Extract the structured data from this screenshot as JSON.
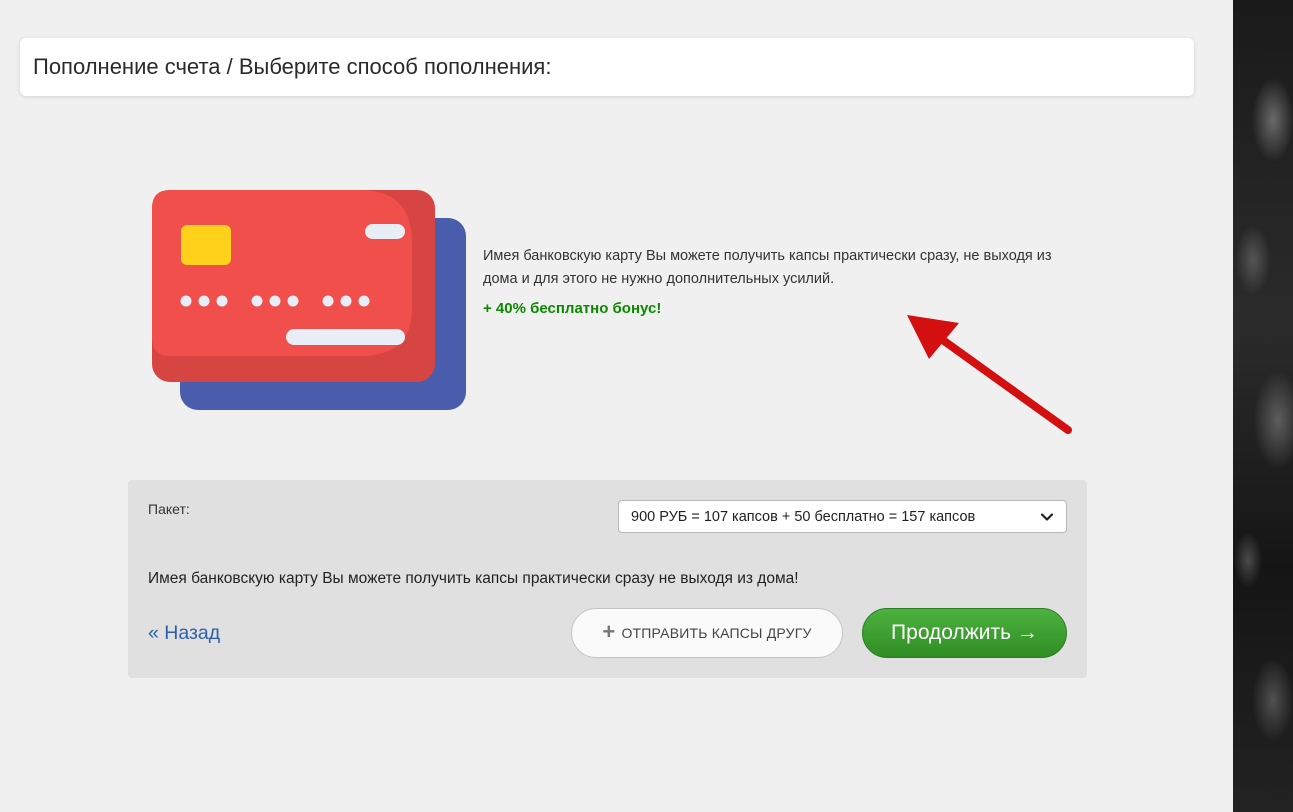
{
  "header": {
    "title": "Пополнение счета / Выберите способ пополнения:"
  },
  "info": {
    "description": "Имея банковскую карту Вы можете получить капсы практически сразу, не выходя из дома и для этого не нужно дополнительных усилий.",
    "bonus": "+ 40% бесплатно бонус!"
  },
  "form": {
    "package_label": "Пакет:",
    "package_selected": "900 РУБ = 107 капсов + 50 бесплатно = 157 капсов",
    "note": "Имея банковскую карту Вы можете получить капсы практически сразу не выходя из дома!",
    "back_label": "« Назад",
    "send_plus": "+",
    "send_label": "ОТПРАВИТЬ КАПСЫ ДРУГУ",
    "continue_label": "Продолжить →"
  },
  "colors": {
    "card_front": "#f04f4c",
    "card_back": "#4a5dac",
    "chip": "#ffd11a",
    "bonus_green": "#0b8a00",
    "link_blue": "#2d5fa8",
    "button_green": "#3a9e2e",
    "arrow_red": "#d40f0f"
  },
  "icons": {
    "illustration": "credit-cards-illustration",
    "pointer": "red-arrow",
    "dropdown": "chevron-down-icon",
    "send": "plus-icon"
  }
}
